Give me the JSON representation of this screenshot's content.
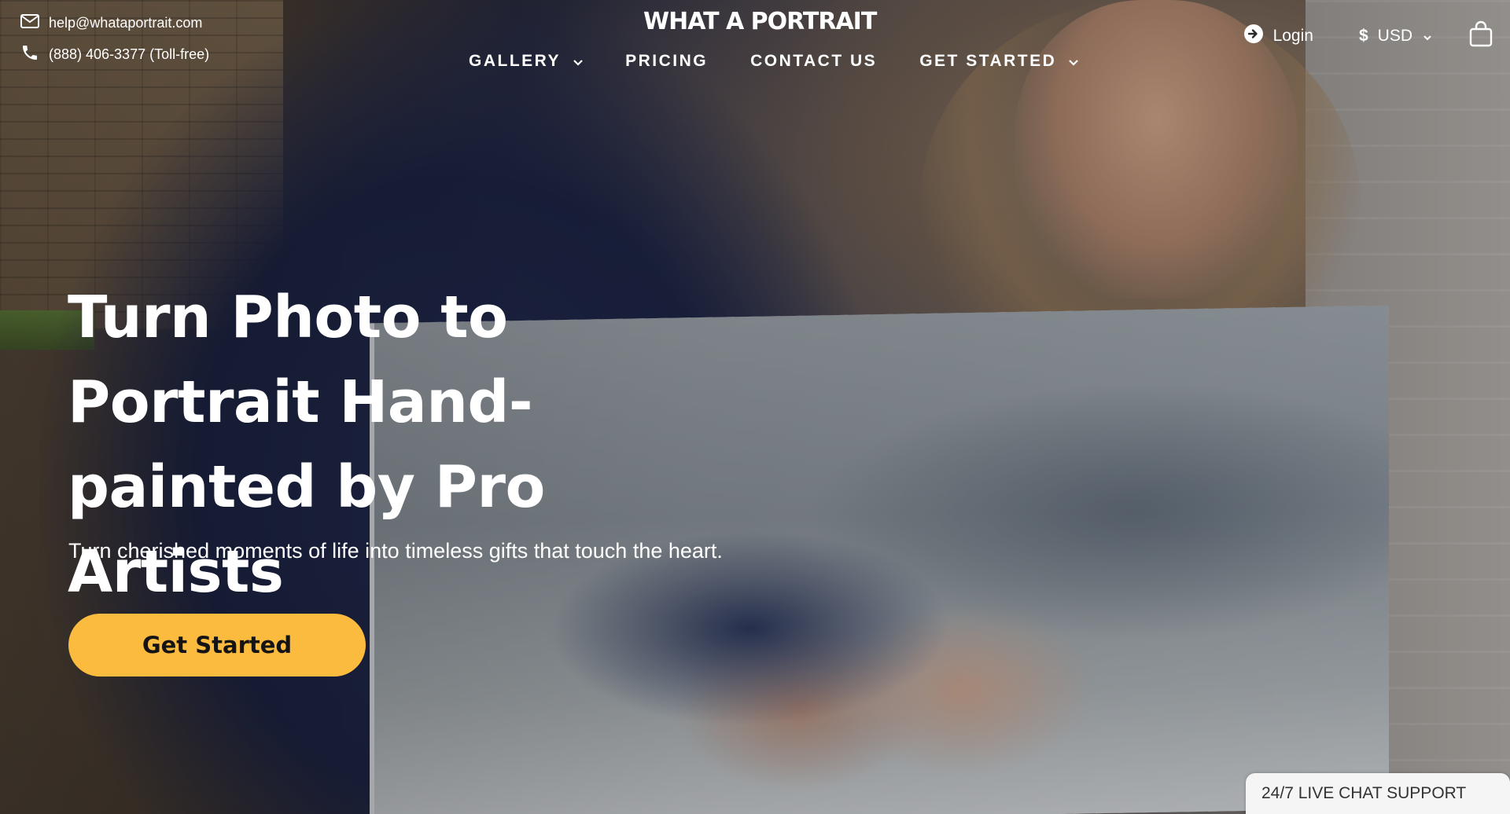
{
  "contact": {
    "email": "help@whataportrait.com",
    "phone": "(888) 406-3377 (Toll-free)"
  },
  "logo": {
    "text": "WHAT A PORTRAIT"
  },
  "nav": {
    "items": [
      {
        "label": "GALLERY",
        "has_dropdown": true
      },
      {
        "label": "PRICING",
        "has_dropdown": false
      },
      {
        "label": "CONTACT US",
        "has_dropdown": false
      },
      {
        "label": "GET STARTED",
        "has_dropdown": true
      }
    ]
  },
  "header": {
    "login_label": "Login",
    "currency_symbol": "$",
    "currency_label": "USD"
  },
  "hero": {
    "headline": "Turn Photo to Portrait Hand-painted by Pro Artists",
    "subtext": "Turn cherished moments of life into timeless gifts that touch the heart.",
    "cta_label": "Get Started"
  },
  "chat": {
    "label": "24/7 LIVE CHAT SUPPORT"
  },
  "colors": {
    "cta_bg": "#fbbb3f",
    "text_light": "#ffffff",
    "chat_bg": "#f5f5f5"
  },
  "icons": [
    "mail-icon",
    "phone-icon",
    "chevron-down-icon",
    "login-arrow-icon",
    "shopping-bag-icon"
  ]
}
